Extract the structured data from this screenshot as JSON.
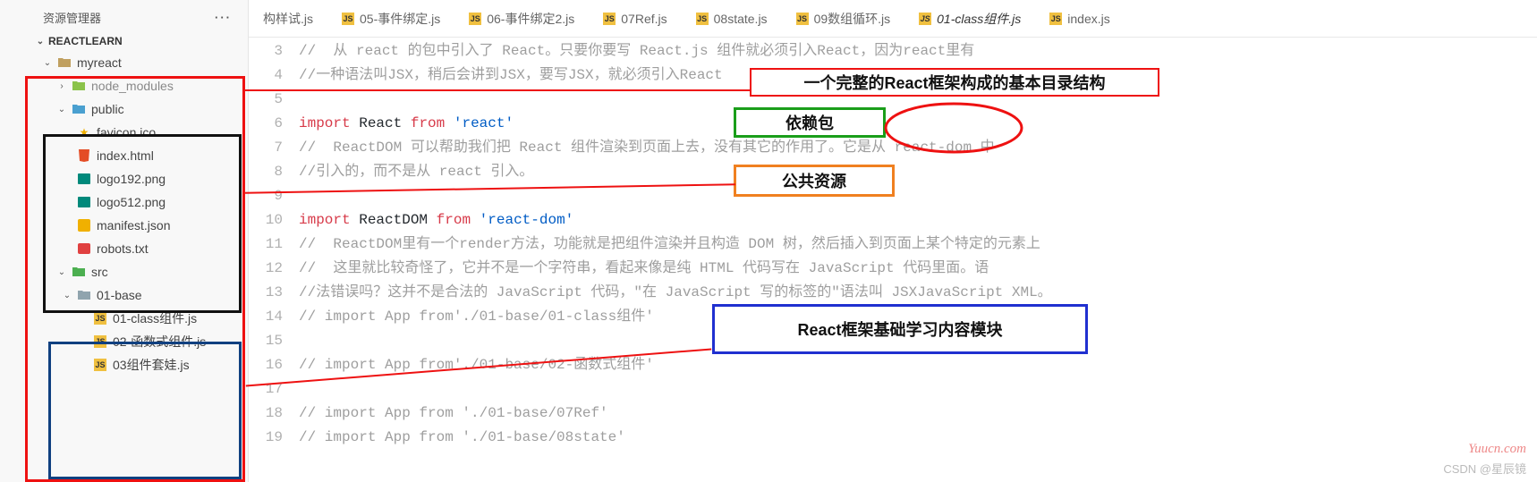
{
  "explorer": {
    "title": "资源管理器",
    "project": "REACTLEARN"
  },
  "tree": {
    "myreact": "myreact",
    "node_modules": "node_modules",
    "public": "public",
    "favicon": "favicon.ico",
    "index_html": "index.html",
    "logo192": "logo192.png",
    "logo512": "logo512.png",
    "manifest": "manifest.json",
    "robots": "robots.txt",
    "src": "src",
    "base01": "01-base",
    "f1": "01-class组件.js",
    "f2": "02-函数式组件.js",
    "f3": "03组件套娃.js"
  },
  "tabs": {
    "t0": "构样试.js",
    "t1": "05-事件绑定.js",
    "t2": "06-事件绑定2.js",
    "t3": "07Ref.js",
    "t4": "08state.js",
    "t5": "09数组循环.js",
    "t6": "01-class组件.js",
    "t7": "index.js"
  },
  "code": {
    "l3": "//  从 react 的包中引入了 React。只要你要写 React.js 组件就必须引入React，因为react里有",
    "l4": "//一种语法叫JSX，稍后会讲到JSX，要写JSX，就必须引入React",
    "l5": "",
    "l6a": "import",
    "l6b": "React",
    "l6c": "from",
    "l6d": "'react'",
    "l7": "//  ReactDOM 可以帮助我们把 React 组件渲染到页面上去，没有其它的作用了。它是从 react-dom 中",
    "l8": "//引入的，而不是从 react 引入。",
    "l9": "",
    "l10a": "import",
    "l10b": "ReactDOM",
    "l10c": "from",
    "l10d": "'react-dom'",
    "l11": "//  ReactDOM里有一个render方法，功能就是把组件渲染并且构造 DOM 树，然后插入到页面上某个特定的元素上",
    "l12": "//  这里就比较奇怪了，它并不是一个字符串，看起来像是纯 HTML 代码写在 JavaScript 代码里面。语",
    "l13": "//法错误吗？这并不是合法的 JavaScript 代码，\"在 JavaScript 写的标签的\"语法叫 JSXJavaScript XML。",
    "l14": "// import App from'./01-base/01-class组件'",
    "l15": "",
    "l16": "// import App from'./01-base/02-函数式组件'",
    "l17": "",
    "l18": "// import App from './01-base/07Ref'",
    "l19": "// import App from './01-base/08state'"
  },
  "annotations": {
    "a1": "一个完整的React框架构成的基本目录结构",
    "a2": "依赖包",
    "a3": "公共资源",
    "a4": "React框架基础学习内容模块"
  },
  "watermark": "Yuucn.com",
  "csdn": "CSDN @星辰镜"
}
